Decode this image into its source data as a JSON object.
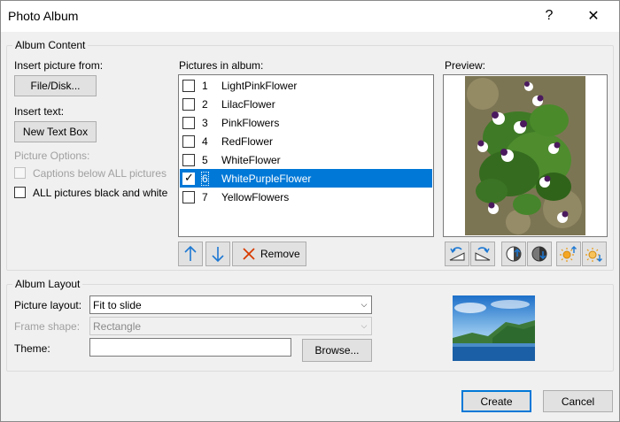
{
  "window": {
    "title": "Photo Album",
    "help_glyph": "?",
    "close_glyph": "✕"
  },
  "album_content": {
    "legend": "Album Content",
    "insert_picture_from": "Insert picture from:",
    "file_disk_button": "File/Disk...",
    "insert_text": "Insert text:",
    "new_text_box_button": "New Text Box",
    "picture_options": "Picture Options:",
    "captions_below": "Captions below ALL pictures",
    "black_and_white": "ALL pictures black and white",
    "pictures_in_album": "Pictures in album:",
    "pictures": [
      {
        "num": "1",
        "name": "LightPinkFlower",
        "checked": false,
        "selected": false
      },
      {
        "num": "2",
        "name": "LilacFlower",
        "checked": false,
        "selected": false
      },
      {
        "num": "3",
        "name": "PinkFlowers",
        "checked": false,
        "selected": false
      },
      {
        "num": "4",
        "name": "RedFlower",
        "checked": false,
        "selected": false
      },
      {
        "num": "5",
        "name": "WhiteFlower",
        "checked": false,
        "selected": false
      },
      {
        "num": "6",
        "name": "WhitePurpleFlower",
        "checked": true,
        "selected": true
      },
      {
        "num": "7",
        "name": "YellowFlowers",
        "checked": false,
        "selected": false
      }
    ],
    "remove_button": "Remove",
    "preview_label": "Preview:"
  },
  "album_layout": {
    "legend": "Album Layout",
    "picture_layout_label": "Picture layout:",
    "picture_layout_value": "Fit to slide",
    "frame_shape_label": "Frame shape:",
    "frame_shape_value": "Rectangle",
    "theme_label": "Theme:",
    "theme_value": "",
    "browse_button": "Browse..."
  },
  "footer": {
    "create_button": "Create",
    "cancel_button": "Cancel"
  },
  "colors": {
    "selection": "#0078d7",
    "dialog_bg": "#f0f0f0",
    "remove_x": "#d83b01",
    "arrow_blue": "#1e78d2"
  }
}
